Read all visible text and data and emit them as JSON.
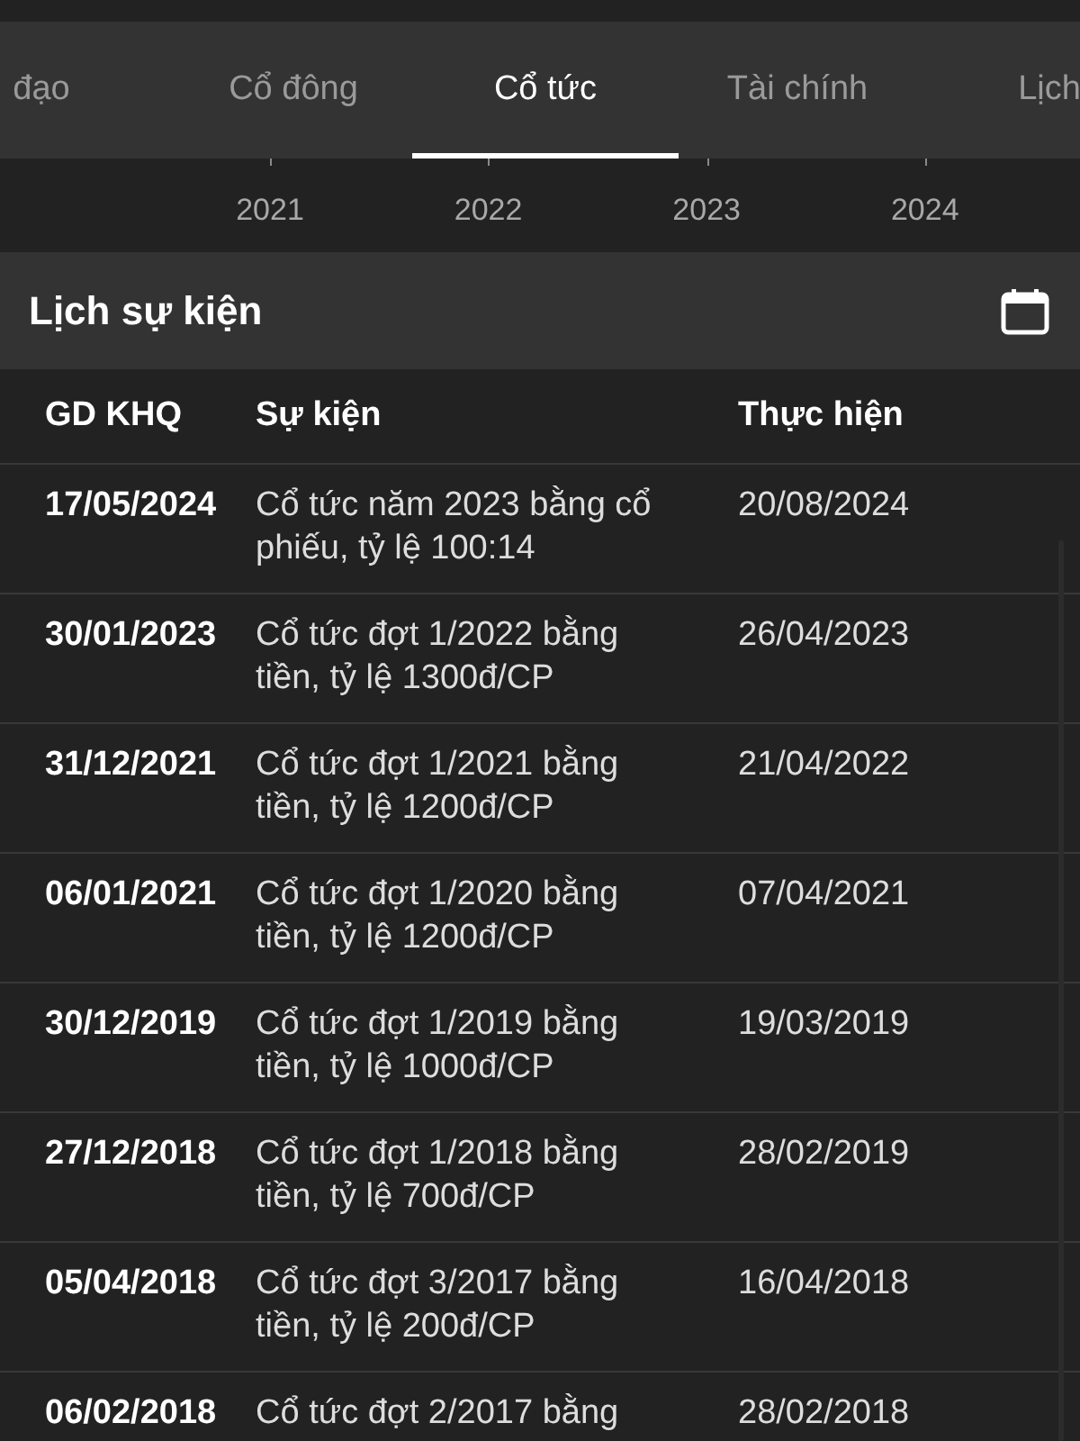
{
  "tabs": [
    {
      "label": "đạo",
      "selected": false
    },
    {
      "label": "Cổ đông",
      "selected": false
    },
    {
      "label": "Cổ tức",
      "selected": true
    },
    {
      "label": "Tài chính",
      "selected": false
    },
    {
      "label": "Lịch",
      "selected": false
    }
  ],
  "years": [
    "2021",
    "2022",
    "2023",
    "2024"
  ],
  "section": {
    "title": "Lịch sự kiện"
  },
  "table": {
    "columns": [
      "GD KHQ",
      "Sự kiện",
      "Thực hiện"
    ],
    "rows": [
      [
        "17/05/2024",
        "Cổ tức năm 2023 bằng cổ phiếu, tỷ lệ 100:14",
        "20/08/2024"
      ],
      [
        "30/01/2023",
        "Cổ tức đợt 1/2022 bằng tiền, tỷ lệ 1300đ/CP",
        "26/04/2023"
      ],
      [
        "31/12/2021",
        "Cổ tức đợt 1/2021 bằng tiền, tỷ lệ 1200đ/CP",
        "21/04/2022"
      ],
      [
        "06/01/2021",
        "Cổ tức đợt 1/2020 bằng tiền, tỷ lệ 1200đ/CP",
        "07/04/2021"
      ],
      [
        "30/12/2019",
        "Cổ tức đợt 1/2019 bằng tiền, tỷ lệ 1000đ/CP",
        "19/03/2019"
      ],
      [
        "27/12/2018",
        "Cổ tức đợt 1/2018 bằng tiền, tỷ lệ 700đ/CP",
        "28/02/2019"
      ],
      [
        "05/04/2018",
        "Cổ tức đợt 3/2017 bằng tiền, tỷ lệ 200đ/CP",
        "16/04/2018"
      ],
      [
        "06/02/2018",
        "Cổ tức đợt 2/2017 bằng",
        "28/02/2018"
      ]
    ]
  }
}
